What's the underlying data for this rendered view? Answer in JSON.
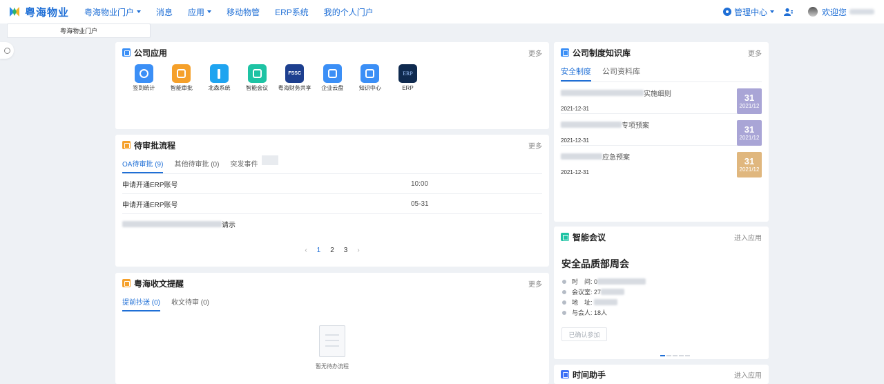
{
  "header": {
    "brand": "粤海物业",
    "nav": [
      {
        "label": "粤海物业门户",
        "dropdown": true
      },
      {
        "label": "消息",
        "dropdown": false
      },
      {
        "label": "应用",
        "dropdown": true
      },
      {
        "label": "移动物管",
        "dropdown": false
      },
      {
        "label": "ERP系统",
        "dropdown": false
      },
      {
        "label": "我的个人门户",
        "dropdown": false
      }
    ],
    "admin_center": "管理中心",
    "welcome": "欢迎您"
  },
  "dropdown_item": "粤海物业门户",
  "apps_card": {
    "title": "公司应用",
    "more": "更多",
    "apps": [
      {
        "label": "签到统计",
        "color": "#3b8ff6",
        "icon": "location-pin-icon"
      },
      {
        "label": "智能审批",
        "color": "#f5a02a",
        "icon": "approval-doc-icon"
      },
      {
        "label": "北森系统",
        "color": "#1fa4f0",
        "icon": "info-icon"
      },
      {
        "label": "智能会议",
        "color": "#1ec3a4",
        "icon": "meeting-screen-icon"
      },
      {
        "label": "粤海财务共享",
        "color": "#1d3f8f",
        "icon": "fssc-logo",
        "badge": "FSSC"
      },
      {
        "label": "企业云盘",
        "color": "#3b8ff6",
        "icon": "folder-icon"
      },
      {
        "label": "知识中心",
        "color": "#3b8ff6",
        "icon": "book-icon"
      },
      {
        "label": "ERP",
        "color": "#0f2a4f",
        "icon": "erp-logo",
        "badge": "ERP"
      }
    ]
  },
  "pending_card": {
    "title": "待审批流程",
    "more": "更多",
    "tabs": [
      "OA待审批 (9)",
      "其他待审批 (0)",
      "突发事件"
    ],
    "rows": [
      {
        "title": "申请开通ERP账号",
        "time": "10:00"
      },
      {
        "title": "申请开通ERP账号",
        "time": "05-31"
      },
      {
        "title": "请示",
        "time": ""
      }
    ],
    "pages": [
      "1",
      "2",
      "3"
    ]
  },
  "receipt_card": {
    "title": "粤海收文提醒",
    "more": "更多",
    "tabs": [
      "提前抄送 (0)",
      "收文待审 (0)"
    ],
    "empty_text": "暂无待办流程"
  },
  "kb_card": {
    "title": "公司制度知识库",
    "more": "更多",
    "tabs": [
      "安全制度",
      "公司资料库"
    ],
    "items": [
      {
        "title_suffix": "实施细则",
        "date": "2021-12-31",
        "day": "31",
        "month": "2021/12",
        "color": "#a9a5d6"
      },
      {
        "title_suffix": "专项预案",
        "date": "2021-12-31",
        "day": "31",
        "month": "2021/12",
        "color": "#a9a5d6"
      },
      {
        "title_suffix": "应急预案",
        "date": "2021-12-31",
        "day": "31",
        "month": "2021/12",
        "color": "#e0b77e"
      }
    ]
  },
  "meeting_card": {
    "title": "智能会议",
    "more": "进入应用",
    "meeting_title": "安全品质部周会",
    "rows": [
      {
        "label": "时　间:",
        "value": "0"
      },
      {
        "label": "会议室:",
        "value": "27"
      },
      {
        "label": "地　址:",
        "value": ""
      },
      {
        "label": "与会人:",
        "value": "18人"
      }
    ],
    "button": "已确认参加"
  },
  "time_card": {
    "title": "时间助手",
    "more": "进入应用"
  }
}
